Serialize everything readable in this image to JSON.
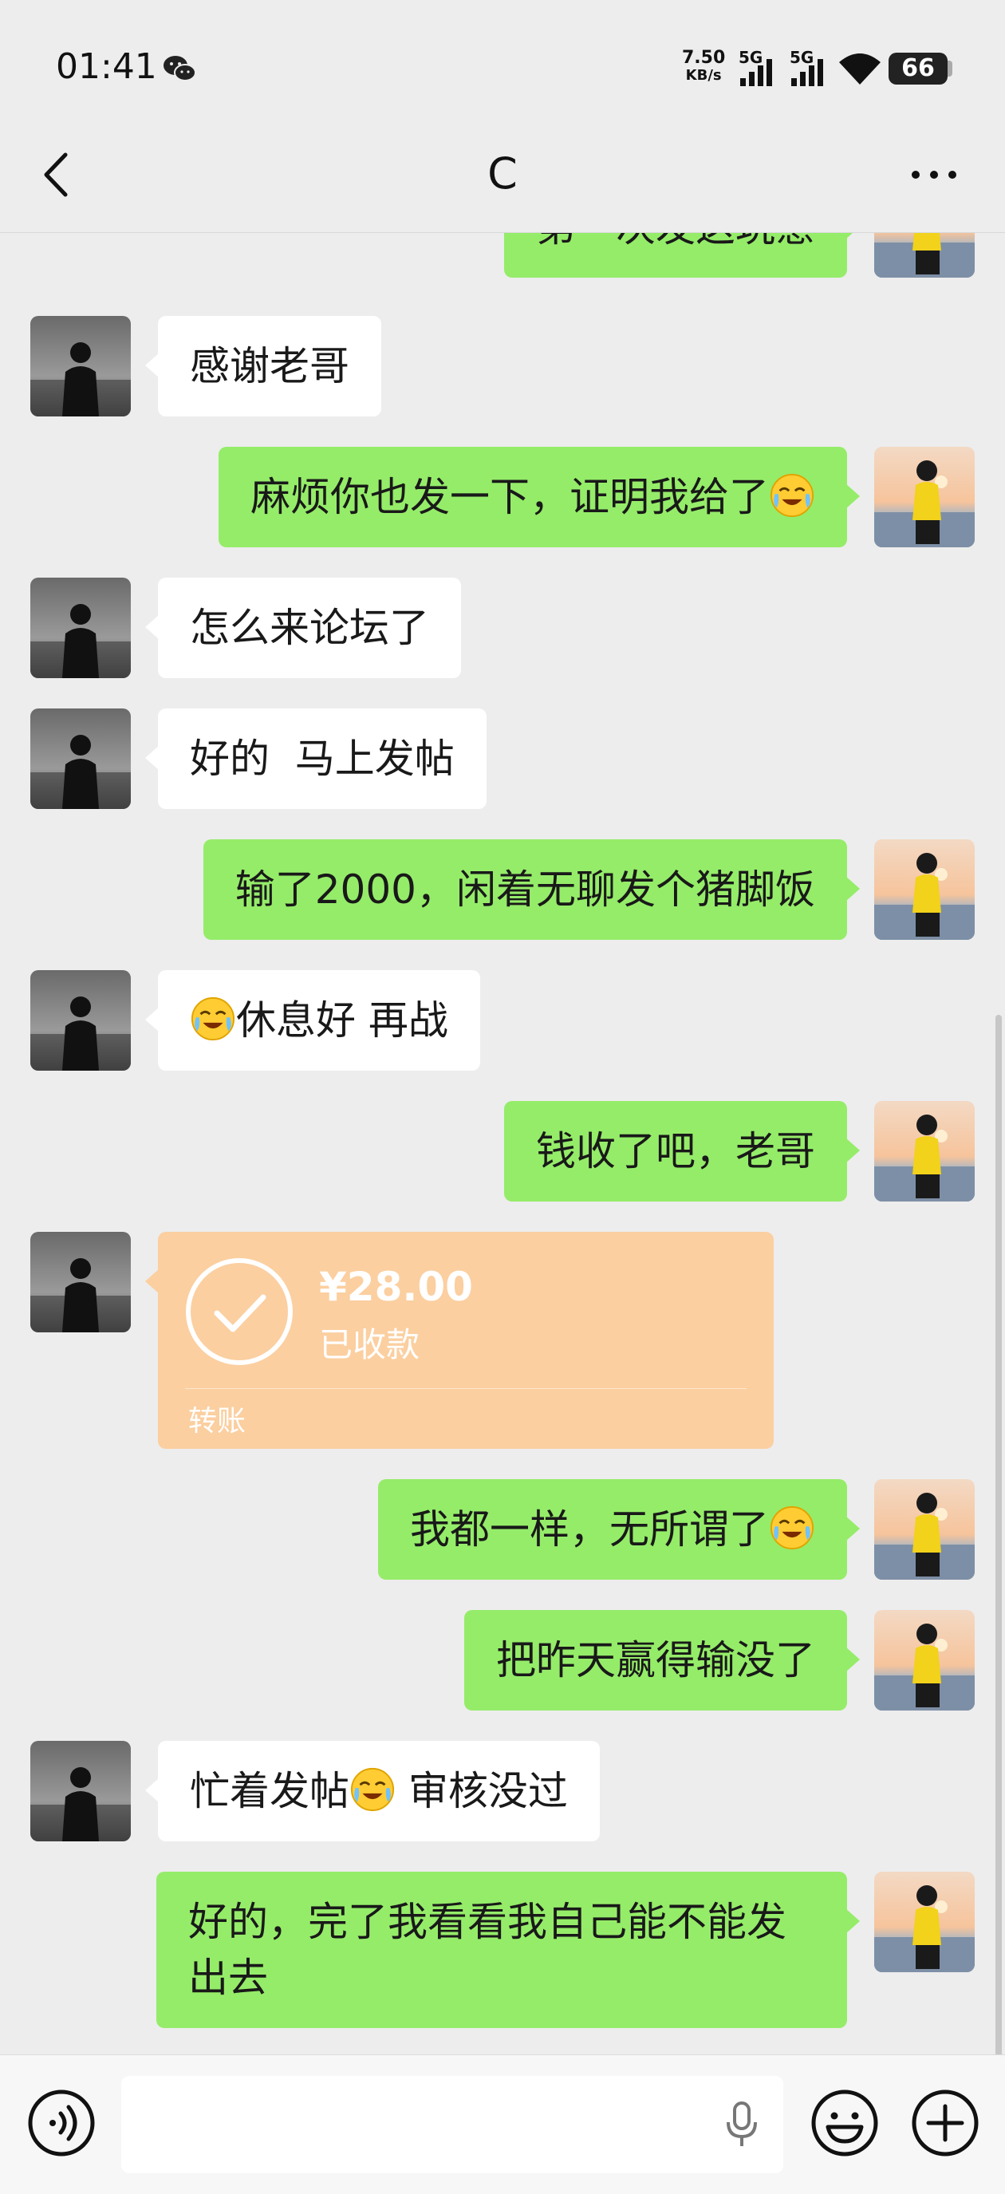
{
  "status_bar": {
    "time": "01:41",
    "speed_value": "7.50",
    "speed_unit": "KB/s",
    "signal_1": "5G",
    "signal_2": "5G",
    "battery": "66"
  },
  "header": {
    "title": "C"
  },
  "messages": [
    {
      "side": "out",
      "text": "第一次发这玩意"
    },
    {
      "side": "in",
      "text": "感谢老哥"
    },
    {
      "side": "out",
      "text": "麻烦你也发一下，证明我给了",
      "emoji_after": true
    },
    {
      "side": "in",
      "text": "怎么来论坛了"
    },
    {
      "side": "in",
      "text": "好的  马上发帖"
    },
    {
      "side": "out",
      "text": "输了2000，闲着无聊发个猪脚饭"
    },
    {
      "side": "in",
      "text": "休息好 再战",
      "emoji_before": true
    },
    {
      "side": "out",
      "text": "钱收了吧，老哥"
    },
    {
      "side": "in",
      "type": "transfer",
      "amount": "¥28.00",
      "status": "已收款",
      "label": "转账"
    },
    {
      "side": "out",
      "text": "我都一样，无所谓了",
      "emoji_after": true
    },
    {
      "side": "out",
      "text": "把昨天赢得输没了"
    },
    {
      "side": "in",
      "text_before": "忙着发帖",
      "text_after": " 审核没过"
    },
    {
      "side": "out",
      "line1": "好的，完了我看看我自己能不能发",
      "line2": "出去"
    }
  ],
  "icons": {
    "back": "back-arrow-icon",
    "more": "more-dots-icon",
    "voice": "voice-input-icon",
    "mic": "microphone-icon",
    "emoji": "emoji-icon",
    "plus": "plus-icon",
    "wechat": "wechat-icon",
    "transfer_check": "check-circle-icon"
  },
  "colors": {
    "background": "#ededed",
    "outgoing_bubble": "#95ec69",
    "incoming_bubble": "#ffffff",
    "transfer_card": "#fbcfa0"
  }
}
